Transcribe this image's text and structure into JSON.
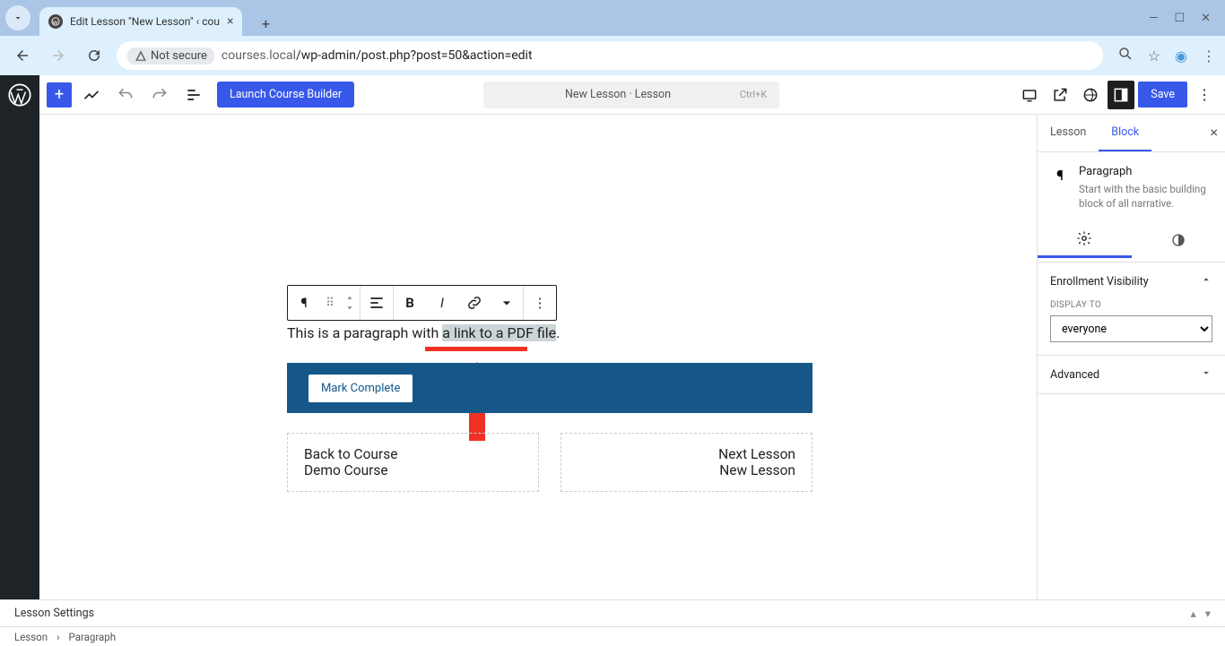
{
  "browser": {
    "tab_title": "Edit Lesson \"New Lesson\" ‹ cou",
    "url_host": "courses.local",
    "url_path": "/wp-admin/post.php?post=50&action=edit",
    "not_secure": "Not secure"
  },
  "header": {
    "launch_btn": "Launch Course Builder",
    "doc_title": "New Lesson · Lesson",
    "shortcut": "Ctrl+K",
    "save_btn": "Save"
  },
  "editor": {
    "paragraph_prefix": "This is a paragraph with ",
    "paragraph_link": "a link to a PDF file",
    "paragraph_suffix": ".",
    "mark_complete": "Mark Complete",
    "nav_prev_label": "Back to Course",
    "nav_prev_value": "Demo Course",
    "nav_next_label": "Next Lesson",
    "nav_next_value": "New Lesson"
  },
  "inspector": {
    "tab_lesson": "Lesson",
    "tab_block": "Block",
    "block_name": "Paragraph",
    "block_desc": "Start with the basic building block of all narrative.",
    "panel_enrollment": "Enrollment Visibility",
    "display_to_label": "DISPLAY TO",
    "display_to_value": "everyone",
    "panel_advanced": "Advanced"
  },
  "footer": {
    "lesson_settings": "Lesson Settings",
    "crumb1": "Lesson",
    "crumb2": "Paragraph"
  }
}
